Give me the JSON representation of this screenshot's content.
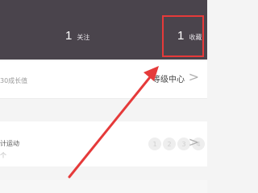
{
  "header": {
    "follow": {
      "count": "1",
      "label": "关注"
    },
    "favorites": {
      "count": "1",
      "label": "收藏"
    }
  },
  "level_row": {
    "left_text": "30成长值",
    "right_label": "等级中心",
    "chevron": ">"
  },
  "sport_row": {
    "left_text": "计运动",
    "sub_text": "个",
    "badges": [
      "1",
      "2",
      "3",
      "4"
    ],
    "chevron": ">"
  },
  "annotation": {
    "box_color": "#e53a3a",
    "arrow_color": "#e53a3a"
  },
  "colors": {
    "header_bg": "#4a444c",
    "page_bg": "#f4f4f4"
  }
}
